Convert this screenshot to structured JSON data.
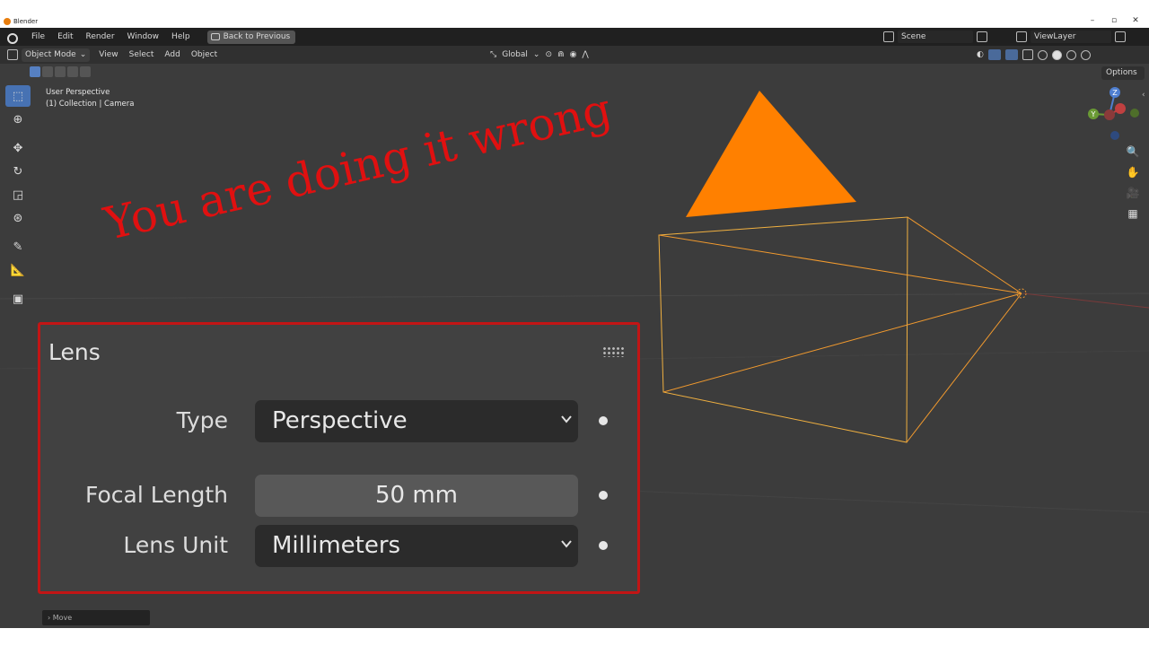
{
  "os_window": {
    "title": "Blender",
    "controls": [
      "–",
      "▫",
      "✕"
    ]
  },
  "topbar": {
    "menus": [
      "File",
      "Edit",
      "Render",
      "Window",
      "Help"
    ],
    "back_button": "Back to Previous",
    "scene": "Scene",
    "view_layer": "ViewLayer"
  },
  "viewport_header": {
    "mode": "Object Mode",
    "menus": [
      "View",
      "Select",
      "Add",
      "Object"
    ],
    "orientation": "Global",
    "options": "Options"
  },
  "viewport": {
    "perspective": "User Perspective",
    "context": "(1) Collection | Camera"
  },
  "overlay_text": "You are doing it wrong",
  "lens_panel": {
    "title": "Lens",
    "type_label": "Type",
    "type_value": "Perspective",
    "focal_label": "Focal Length",
    "focal_value": "50 mm",
    "unit_label": "Lens Unit",
    "unit_value": "Millimeters"
  },
  "operator_panel": {
    "label": "Move"
  },
  "gizmo": {
    "x": "X",
    "y": "Y",
    "z": "Z"
  },
  "colors": {
    "accent": "#4772b3",
    "camera_selected": "#f29a2e",
    "triangle": "#ff8000",
    "overlay_text": "#e01010",
    "panel_border": "#c21515"
  }
}
